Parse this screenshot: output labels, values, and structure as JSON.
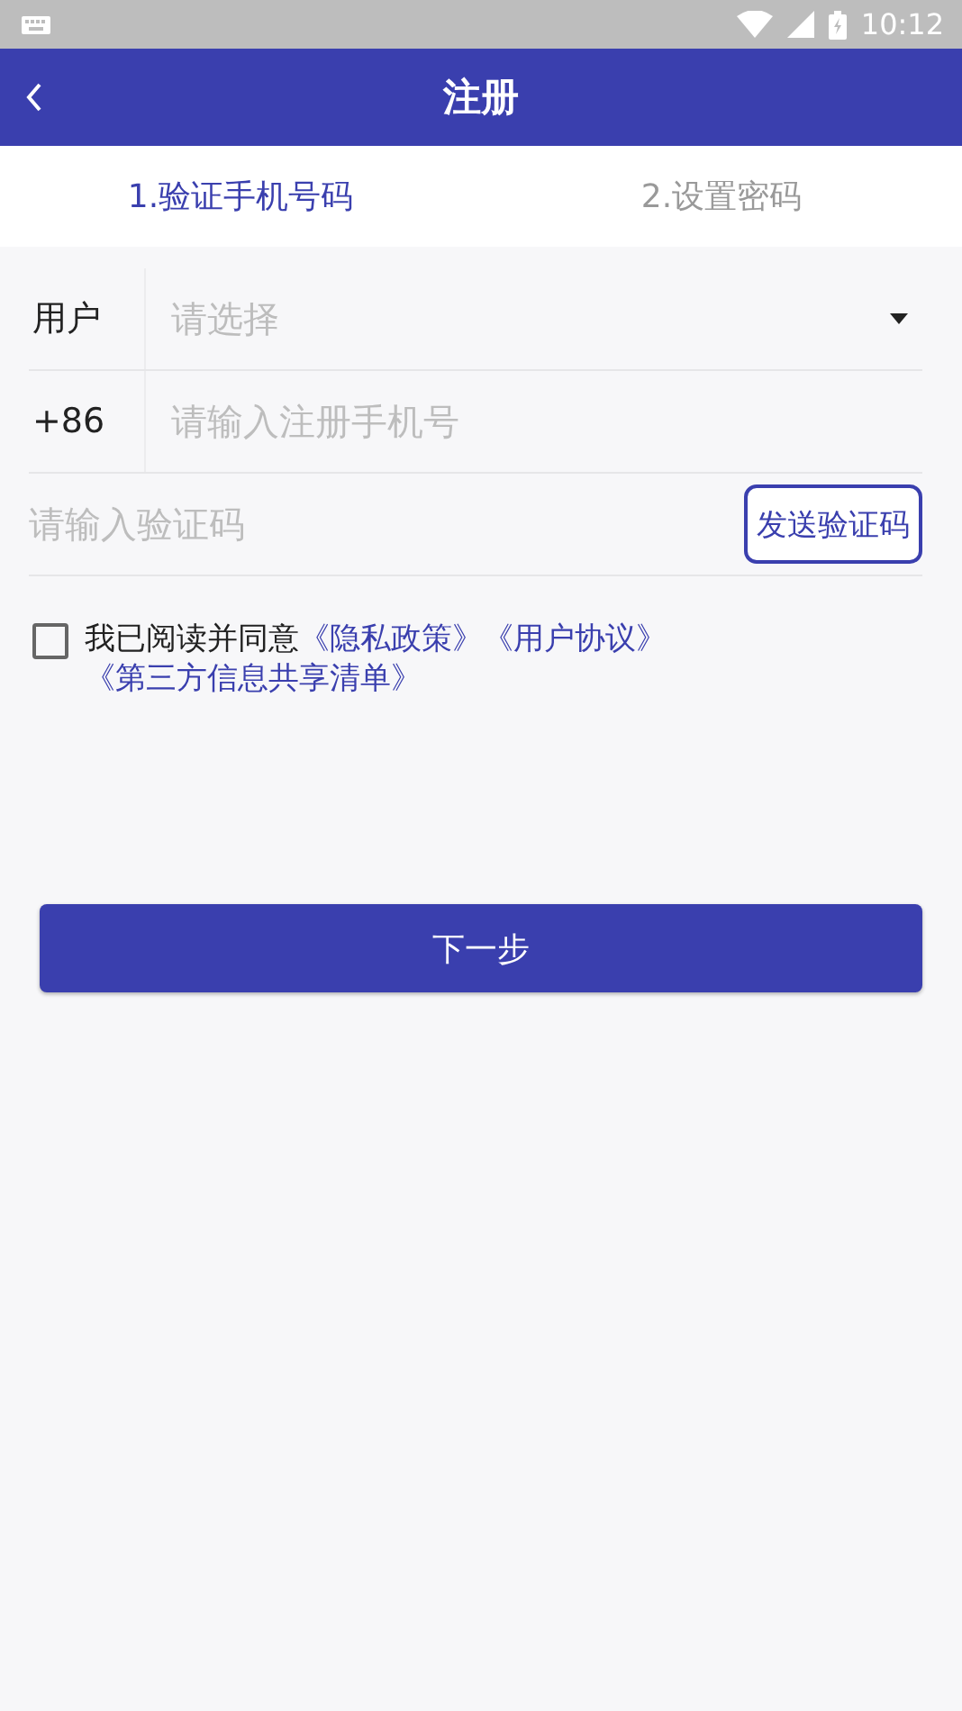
{
  "status_bar": {
    "time": "10:12"
  },
  "header": {
    "title": "注册"
  },
  "steps": [
    {
      "label": "1.验证手机号码",
      "selected": true
    },
    {
      "label": "2.设置密码",
      "selected": false
    }
  ],
  "form": {
    "user_type": {
      "label": "用户",
      "placeholder": "请选择"
    },
    "phone": {
      "prefix": "+86",
      "placeholder": "请输入注册手机号"
    },
    "code": {
      "placeholder": "请输入验证码",
      "button": "发送验证码"
    }
  },
  "agreement": {
    "checked": false,
    "text": "我已阅读并同意",
    "links": [
      "《隐私政策》",
      "《用户协议》",
      "《第三方信息共享清单》"
    ]
  },
  "submit": "下一步"
}
